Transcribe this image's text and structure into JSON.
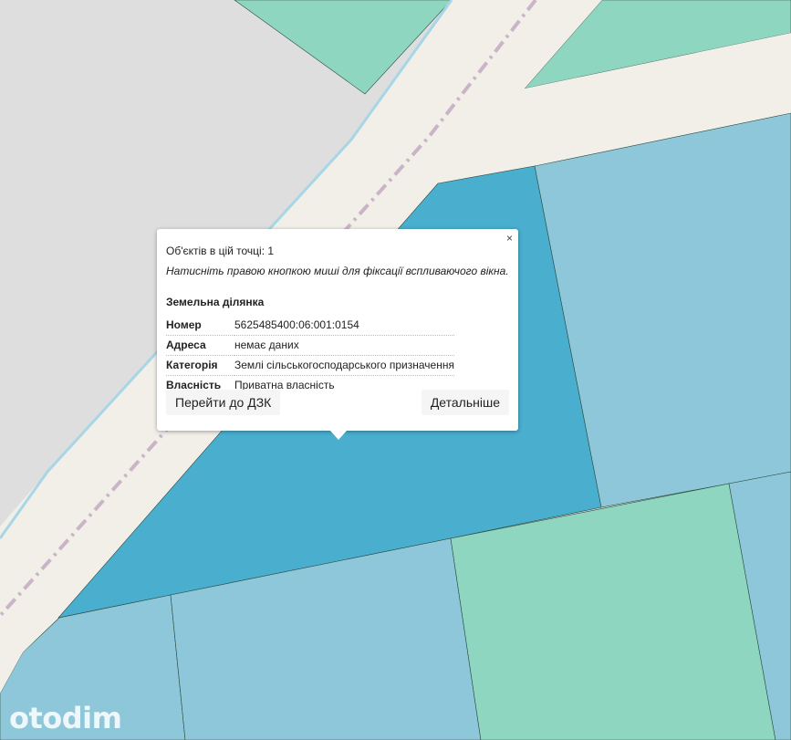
{
  "map": {
    "colors": {
      "background": "#dedede",
      "road": "#f2efe9",
      "road_dash": "#c9b4c8",
      "water_line": "#a8d6e6",
      "green_parcel": "#8fd6c1",
      "blue_parcel": "#8ec7d9",
      "selected_parcel": "#4aaecf",
      "parcel_border": "#2a4a3f"
    }
  },
  "popup": {
    "objects_count": "Об'єктів в цій точці: 1",
    "hint": "Натисніть правою кнопкою миші для фіксації вспливаючого вікна.",
    "section_title": "Земельна ділянка",
    "close_label": "×",
    "attributes": [
      {
        "key": "Номер",
        "value": "5625485400:06:001:0154"
      },
      {
        "key": "Адреса",
        "value": "немає даних"
      },
      {
        "key": "Категорія",
        "value": "Землі сільськогосподарського призначення"
      },
      {
        "key": "Власність",
        "value": "Приватна власність"
      }
    ],
    "buttons": {
      "dzk": "Перейти до ДЗК",
      "details": "Детальніше"
    }
  },
  "watermark": "otodim"
}
